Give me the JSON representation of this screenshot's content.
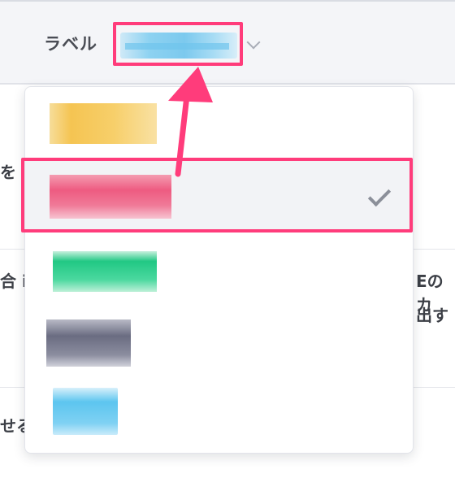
{
  "header": {
    "label": "ラベル"
  },
  "background_text": {
    "row1_left": "を",
    "row2_left": "合 i",
    "row2_right_top": "Eのカ",
    "row2_right_bottom": "出す",
    "row3_left": "せる"
  },
  "dropdown": {
    "options": [
      {
        "name": "yellow",
        "color": "#f6c85a",
        "selected": false
      },
      {
        "name": "pink",
        "color": "#ef5a80",
        "selected": true
      },
      {
        "name": "green",
        "color": "#2ec987",
        "selected": false
      },
      {
        "name": "gray",
        "color": "#6b6d82",
        "selected": false
      },
      {
        "name": "blue",
        "color": "#5cc4ef",
        "selected": false
      }
    ],
    "selected_icon": "checkmark-icon"
  },
  "annotation": {
    "highlight_color": "#ff3c7b"
  }
}
